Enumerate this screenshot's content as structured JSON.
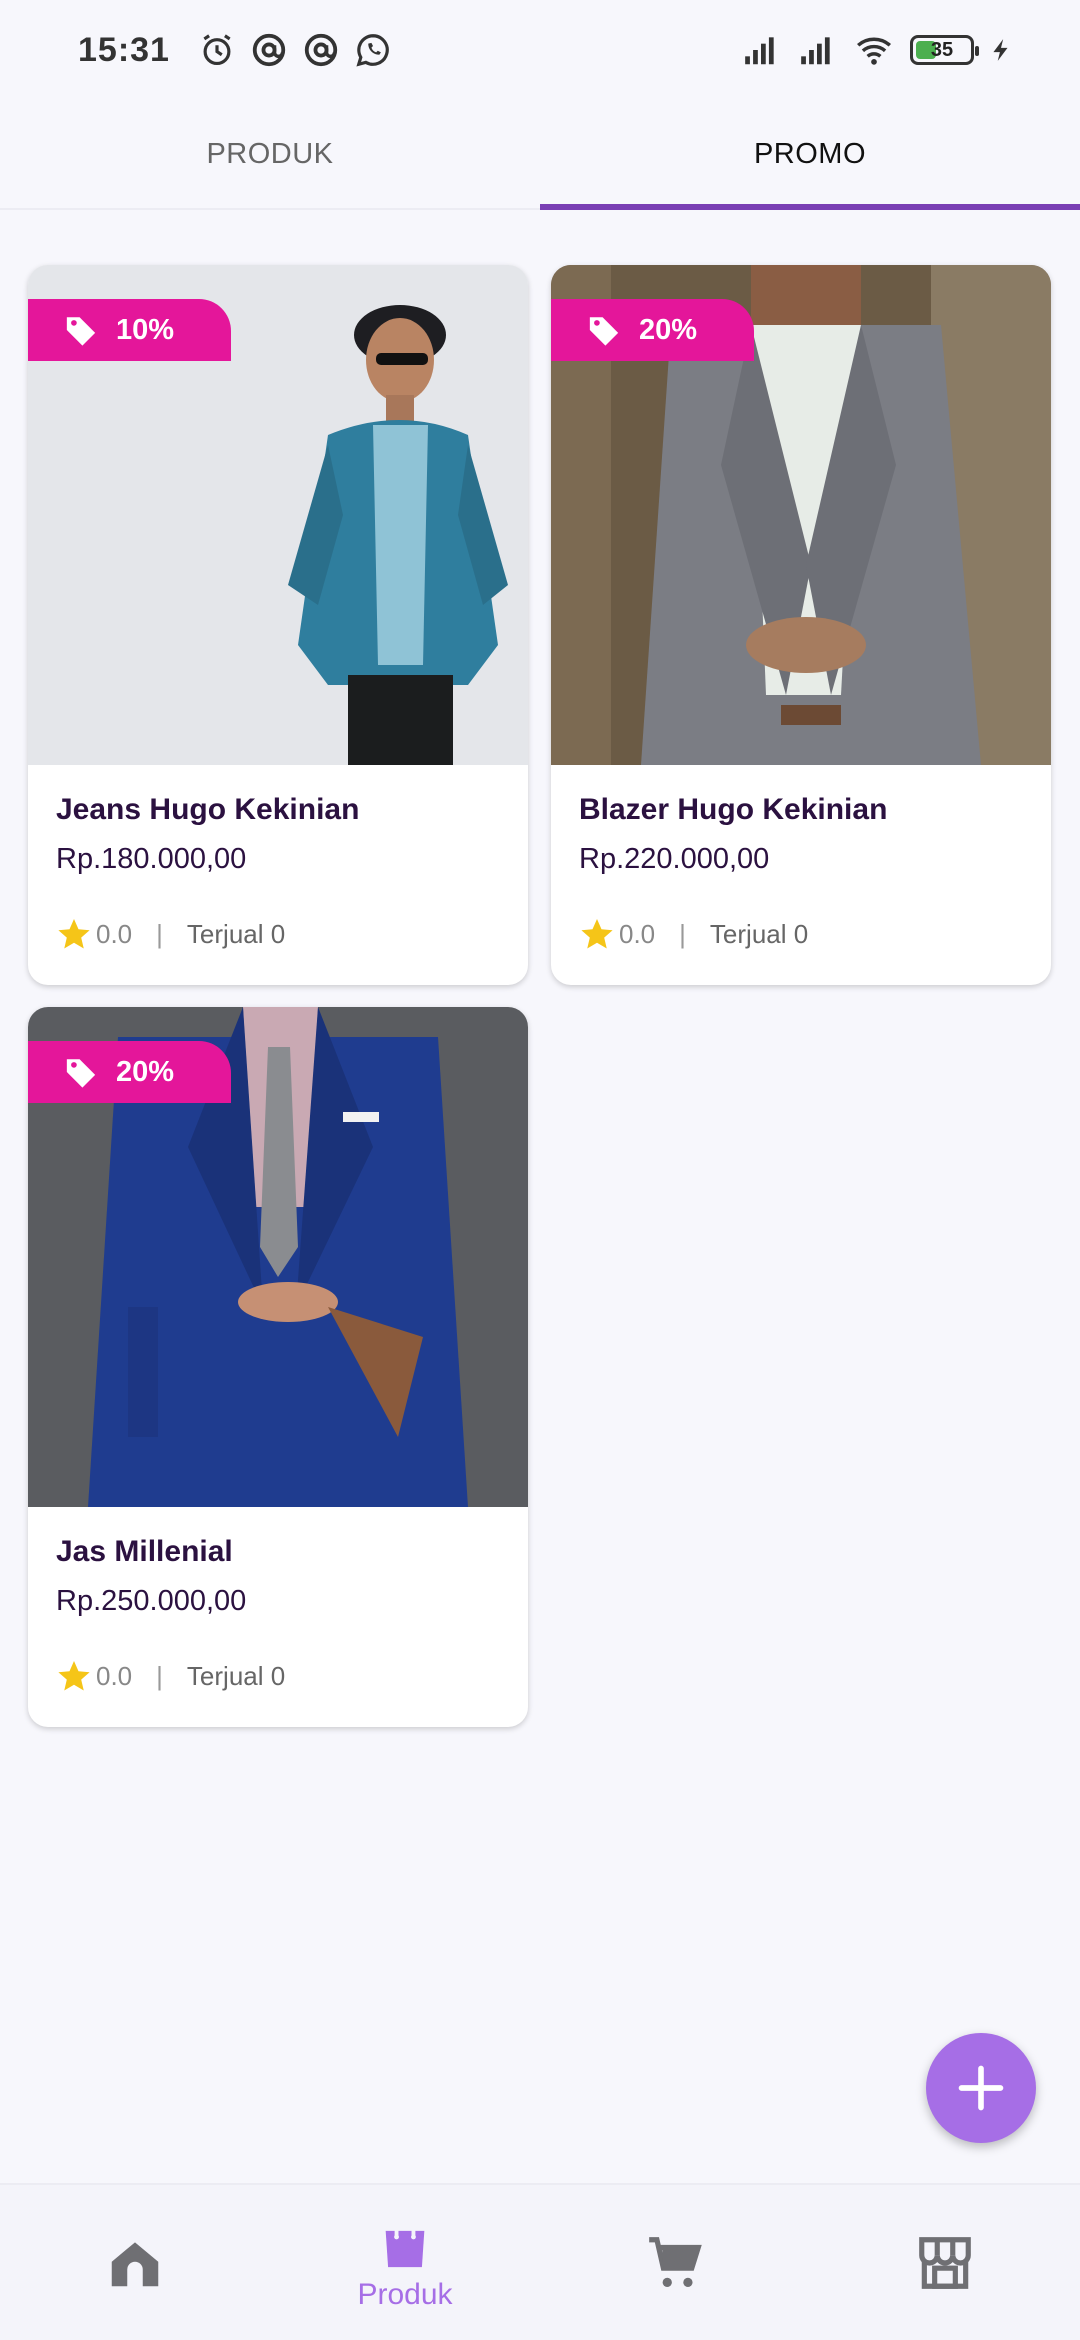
{
  "status_bar": {
    "time": "15:31",
    "battery_level": "35",
    "icons": [
      "alarm-icon",
      "at-sign-icon",
      "at-sign-icon",
      "whatsapp-icon",
      "signal-icon",
      "signal-icon",
      "wifi-icon",
      "battery-icon",
      "charging-icon"
    ]
  },
  "tabs": [
    {
      "label": "PRODUK",
      "active": false
    },
    {
      "label": "PROMO",
      "active": true
    }
  ],
  "products": [
    {
      "discount": "10%",
      "name": "Jeans Hugo Kekinian",
      "price": "Rp.180.000,00",
      "rating": "0.0",
      "sold": "Terjual 0",
      "image": "man-in-denim-jacket-photo"
    },
    {
      "discount": "20%",
      "name": "Blazer Hugo Kekinian",
      "price": "Rp.220.000,00",
      "rating": "0.0",
      "sold": "Terjual 0",
      "image": "man-in-grey-blazer-photo"
    },
    {
      "discount": "20%",
      "name": "Jas Millenial",
      "price": "Rp.250.000,00",
      "rating": "0.0",
      "sold": "Terjual 0",
      "image": "man-in-blue-suit-photo"
    }
  ],
  "meta_separator": "|",
  "bottom_nav": [
    {
      "icon": "home-icon",
      "label": "",
      "active": false
    },
    {
      "icon": "shopping-bag-icon",
      "label": "Produk",
      "active": true
    },
    {
      "icon": "cart-icon",
      "label": "",
      "active": false
    },
    {
      "icon": "store-icon",
      "label": "",
      "active": false
    }
  ],
  "colors": {
    "accent": "#7a3fb4",
    "fab": "#a66ee6",
    "badge": "#e4169a",
    "title": "#2b1140",
    "star": "#f5c518"
  }
}
